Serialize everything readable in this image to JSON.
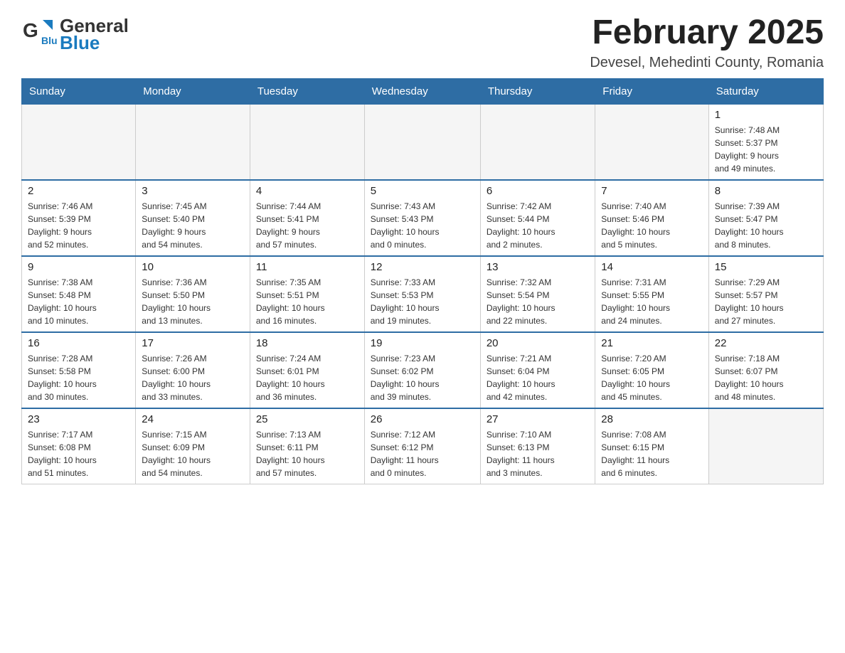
{
  "header": {
    "logo_general": "General",
    "logo_blue": "Blue",
    "month_title": "February 2025",
    "location": "Devesel, Mehedinti County, Romania"
  },
  "weekdays": [
    "Sunday",
    "Monday",
    "Tuesday",
    "Wednesday",
    "Thursday",
    "Friday",
    "Saturday"
  ],
  "weeks": [
    [
      {
        "day": "",
        "info": ""
      },
      {
        "day": "",
        "info": ""
      },
      {
        "day": "",
        "info": ""
      },
      {
        "day": "",
        "info": ""
      },
      {
        "day": "",
        "info": ""
      },
      {
        "day": "",
        "info": ""
      },
      {
        "day": "1",
        "info": "Sunrise: 7:48 AM\nSunset: 5:37 PM\nDaylight: 9 hours\nand 49 minutes."
      }
    ],
    [
      {
        "day": "2",
        "info": "Sunrise: 7:46 AM\nSunset: 5:39 PM\nDaylight: 9 hours\nand 52 minutes."
      },
      {
        "day": "3",
        "info": "Sunrise: 7:45 AM\nSunset: 5:40 PM\nDaylight: 9 hours\nand 54 minutes."
      },
      {
        "day": "4",
        "info": "Sunrise: 7:44 AM\nSunset: 5:41 PM\nDaylight: 9 hours\nand 57 minutes."
      },
      {
        "day": "5",
        "info": "Sunrise: 7:43 AM\nSunset: 5:43 PM\nDaylight: 10 hours\nand 0 minutes."
      },
      {
        "day": "6",
        "info": "Sunrise: 7:42 AM\nSunset: 5:44 PM\nDaylight: 10 hours\nand 2 minutes."
      },
      {
        "day": "7",
        "info": "Sunrise: 7:40 AM\nSunset: 5:46 PM\nDaylight: 10 hours\nand 5 minutes."
      },
      {
        "day": "8",
        "info": "Sunrise: 7:39 AM\nSunset: 5:47 PM\nDaylight: 10 hours\nand 8 minutes."
      }
    ],
    [
      {
        "day": "9",
        "info": "Sunrise: 7:38 AM\nSunset: 5:48 PM\nDaylight: 10 hours\nand 10 minutes."
      },
      {
        "day": "10",
        "info": "Sunrise: 7:36 AM\nSunset: 5:50 PM\nDaylight: 10 hours\nand 13 minutes."
      },
      {
        "day": "11",
        "info": "Sunrise: 7:35 AM\nSunset: 5:51 PM\nDaylight: 10 hours\nand 16 minutes."
      },
      {
        "day": "12",
        "info": "Sunrise: 7:33 AM\nSunset: 5:53 PM\nDaylight: 10 hours\nand 19 minutes."
      },
      {
        "day": "13",
        "info": "Sunrise: 7:32 AM\nSunset: 5:54 PM\nDaylight: 10 hours\nand 22 minutes."
      },
      {
        "day": "14",
        "info": "Sunrise: 7:31 AM\nSunset: 5:55 PM\nDaylight: 10 hours\nand 24 minutes."
      },
      {
        "day": "15",
        "info": "Sunrise: 7:29 AM\nSunset: 5:57 PM\nDaylight: 10 hours\nand 27 minutes."
      }
    ],
    [
      {
        "day": "16",
        "info": "Sunrise: 7:28 AM\nSunset: 5:58 PM\nDaylight: 10 hours\nand 30 minutes."
      },
      {
        "day": "17",
        "info": "Sunrise: 7:26 AM\nSunset: 6:00 PM\nDaylight: 10 hours\nand 33 minutes."
      },
      {
        "day": "18",
        "info": "Sunrise: 7:24 AM\nSunset: 6:01 PM\nDaylight: 10 hours\nand 36 minutes."
      },
      {
        "day": "19",
        "info": "Sunrise: 7:23 AM\nSunset: 6:02 PM\nDaylight: 10 hours\nand 39 minutes."
      },
      {
        "day": "20",
        "info": "Sunrise: 7:21 AM\nSunset: 6:04 PM\nDaylight: 10 hours\nand 42 minutes."
      },
      {
        "day": "21",
        "info": "Sunrise: 7:20 AM\nSunset: 6:05 PM\nDaylight: 10 hours\nand 45 minutes."
      },
      {
        "day": "22",
        "info": "Sunrise: 7:18 AM\nSunset: 6:07 PM\nDaylight: 10 hours\nand 48 minutes."
      }
    ],
    [
      {
        "day": "23",
        "info": "Sunrise: 7:17 AM\nSunset: 6:08 PM\nDaylight: 10 hours\nand 51 minutes."
      },
      {
        "day": "24",
        "info": "Sunrise: 7:15 AM\nSunset: 6:09 PM\nDaylight: 10 hours\nand 54 minutes."
      },
      {
        "day": "25",
        "info": "Sunrise: 7:13 AM\nSunset: 6:11 PM\nDaylight: 10 hours\nand 57 minutes."
      },
      {
        "day": "26",
        "info": "Sunrise: 7:12 AM\nSunset: 6:12 PM\nDaylight: 11 hours\nand 0 minutes."
      },
      {
        "day": "27",
        "info": "Sunrise: 7:10 AM\nSunset: 6:13 PM\nDaylight: 11 hours\nand 3 minutes."
      },
      {
        "day": "28",
        "info": "Sunrise: 7:08 AM\nSunset: 6:15 PM\nDaylight: 11 hours\nand 6 minutes."
      },
      {
        "day": "",
        "info": ""
      }
    ]
  ]
}
